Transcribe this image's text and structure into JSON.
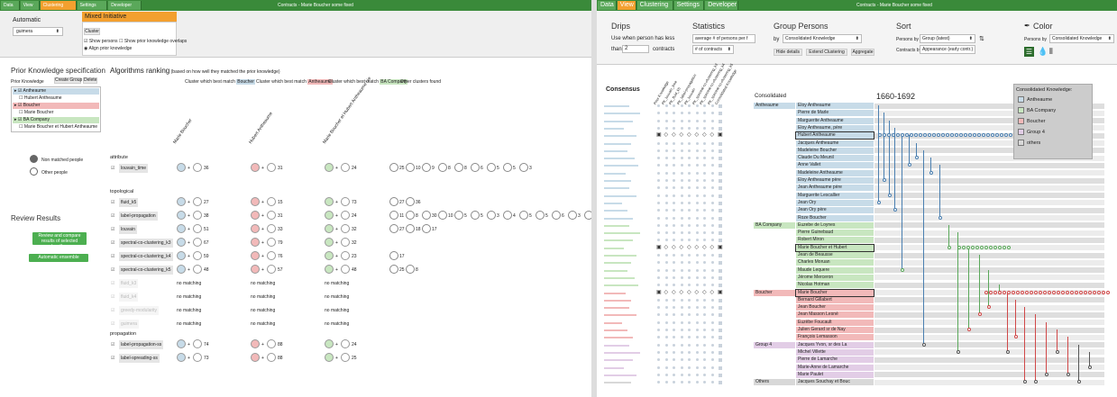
{
  "left": {
    "tabs": [
      "Data",
      "View",
      "Clustering",
      "Settings",
      "Developer"
    ],
    "active_tab": "Clustering",
    "title": "Contracts - Marie Boucher some fixed",
    "automatic_label": "Automatic",
    "algo_select": "guimera",
    "mixed_label": "Mixed Initiative",
    "cluster_btn": "Cluster",
    "show_persons": "Show persons",
    "show_overlaps": "Show prior knowledge overlaps",
    "align_prior": "Align prior knowledge",
    "pk_spec_title": "Prior Knowledge specification",
    "pk_label": "Prior Knowledge",
    "create_group": "Create Group",
    "delete": "Delete",
    "pk_items": [
      {
        "label": "Antheaume",
        "kind": "group",
        "color": "#c7dbe8"
      },
      {
        "label": "Hubert Antheaume",
        "kind": "member",
        "color": ""
      },
      {
        "label": "Boucher",
        "kind": "group",
        "color": "#f2b9b9"
      },
      {
        "label": "Marie Boucher",
        "kind": "member",
        "color": ""
      },
      {
        "label": "BA Company",
        "kind": "group",
        "color": "#c8e6c0"
      },
      {
        "label": "Marie Boucher et Hubert Antheaume",
        "kind": "member",
        "color": ""
      }
    ],
    "non_matched": "Non matched people",
    "other_people": "Other people",
    "review_title": "Review Results",
    "review_btn": "Review and compare results of selected algorithms",
    "ensemble_btn": "Automatic ensemble clustering",
    "alg_title": "Algorithms ranking",
    "alg_subtitle": "(based on how well they matched the prior knowledge)",
    "best_match_prefix": "Cluster which best match",
    "best_boucher": "Boucher",
    "best_antheaume": "Antheaume",
    "best_ba": "BA Company",
    "other_clusters": "Other clusters found",
    "col_heads": [
      "Marie Boucher",
      "Hubert Antheaume",
      "Marie Boucher et Hubert Antheaume Lie"
    ],
    "sections": [
      {
        "name": "attribute",
        "rows": [
          {
            "name": "louvain_time",
            "en": true,
            "v": [
              "36",
              "31",
              "24"
            ],
            "others": [
              "25",
              "10",
              "9",
              "8",
              "8",
              "6",
              "5",
              "5",
              "3"
            ]
          }
        ]
      },
      {
        "name": "topological",
        "rows": [
          {
            "name": "fluid_k5",
            "en": true,
            "v": [
              "27",
              "15",
              "73"
            ],
            "others": [
              "27",
              "36"
            ]
          },
          {
            "name": "label-propagation",
            "en": true,
            "v": [
              "38",
              "31",
              "24"
            ],
            "others": [
              "11",
              "8",
              "30",
              "10",
              "5",
              "5",
              "3",
              "4",
              "5",
              "5",
              "6",
              "3",
              "8"
            ]
          },
          {
            "name": "louvain",
            "en": true,
            "v": [
              "51",
              "33",
              "32"
            ],
            "others": [
              "27",
              "18",
              "17"
            ]
          },
          {
            "name": "spectral-co-clustering_k3",
            "en": true,
            "v": [
              "67",
              "79",
              "32"
            ],
            "others": []
          },
          {
            "name": "spectral-co-clustering_k4",
            "en": true,
            "v": [
              "59",
              "76",
              "23"
            ],
            "others": [
              "17"
            ]
          },
          {
            "name": "spectral-co-clustering_k5",
            "en": true,
            "v": [
              "48",
              "57",
              "48"
            ],
            "others": [
              "25",
              "8"
            ]
          },
          {
            "name": "fluid_k3",
            "en": false,
            "v": [
              "no matching",
              "no matching",
              "no matching"
            ],
            "others": []
          },
          {
            "name": "fluid_k4",
            "en": false,
            "v": [
              "no matching",
              "no matching",
              "no matching"
            ],
            "others": []
          },
          {
            "name": "greedy-modularity",
            "en": false,
            "v": [
              "no matching",
              "no matching",
              "no matching"
            ],
            "others": []
          },
          {
            "name": "guimera",
            "en": false,
            "v": [
              "no matching",
              "no matching",
              "no matching"
            ],
            "others": []
          }
        ]
      },
      {
        "name": "propagation",
        "rows": [
          {
            "name": "label-propagation-ss",
            "en": true,
            "v": [
              "74",
              "88",
              "24"
            ],
            "others": []
          },
          {
            "name": "label-spreading-ss",
            "en": true,
            "v": [
              "73",
              "88",
              "25"
            ],
            "others": []
          }
        ]
      }
    ]
  },
  "right": {
    "tabs": [
      "Data",
      "View",
      "Clustering",
      "Settings",
      "Developer"
    ],
    "active_tab": "View",
    "title": "Contracts - Marie Boucher some fixed",
    "drips_title": "Drips",
    "drips_text1": "Use when person has less",
    "drips_than": "than",
    "drips_value": "2",
    "drips_contracts": "contracts",
    "stats_title": "Statistics",
    "stats_sel1": "average # of persons per f",
    "stats_sel2": "# of contracts",
    "gp_title": "Group Persons",
    "gp_by": "by",
    "gp_sel": "Consolidated Knowledge",
    "hide_details": "Hide details",
    "extend_clustering": "Extend Clustering",
    "aggregate": "Aggregate",
    "sort_title": "Sort",
    "sort_persons_by": "Persons by",
    "sort_persons_sel": "Group (latest)",
    "sort_contracts_by": "Contracts by",
    "sort_contracts_sel": "Appearance (early contr.)",
    "color_title": "Color",
    "color_persons_by": "Persons by",
    "color_sel": "Consolidated Knowledge",
    "consensus": "Consensus",
    "consolidated": "Consolidated",
    "year_range": "1660-1692",
    "matrix_cols": [
      "Prior Knowledge",
      "PK_louvain_time",
      "PK_fluid_k5",
      "PK_label-propagation",
      "PK_louvain",
      "PK_spectral-co-clustering_k3",
      "PK_spectral-co-clustering_k4",
      "PK_spectral-co-clustering_k5",
      "Consolidated Knowledge"
    ],
    "legend_title": "Consolidated Knowledge:",
    "legend": [
      {
        "label": "Antheaume",
        "color": "#c7dbe8"
      },
      {
        "label": "BA Company",
        "color": "#c8e6c0"
      },
      {
        "label": "Boucher",
        "color": "#f2b9b9"
      },
      {
        "label": "Group 4",
        "color": "#e2cde6"
      },
      {
        "label": "others",
        "color": "#d8d8d8"
      }
    ],
    "groups": [
      {
        "name": "Antheaume",
        "color": "#c7dbe8",
        "line": "#4a7fb0",
        "persons": [
          "Eloy Antheaume",
          "Pierre de Marle",
          "Marguerite Antheaume",
          "Eloy Antheaume, père",
          "Hubert Antheaume",
          "Jacques Antheaume",
          "Madeleine Boucher",
          "Claude Du Meunil",
          "Anne Vallet",
          "Madeleine Antheaume",
          "Eloy Antheaume père",
          "Jean Antheaume père",
          "Marguerite Lescallier",
          "Jean Ory",
          "Jean Ory père",
          "Roze Boucher"
        ]
      },
      {
        "name": "BA Company",
        "color": "#c8e6c0",
        "line": "#5aa85a",
        "persons": [
          "Euzebe de Loynes",
          "Pierre Guinebaud",
          "Robert Miron",
          "Marie Boucher et Hubert",
          "Jean de Beausse",
          "Charles Moruan",
          "Maude Lequere",
          "Jérome Merceron",
          "Nicolas Hotman"
        ]
      },
      {
        "name": "Boucher",
        "color": "#f2b9b9",
        "line": "#d04848",
        "persons": [
          "Marie Boucher",
          "Bernard Gillabert",
          "Jean Boucher",
          "Jean Masson Lesné",
          "Euzèbe Foucault",
          "Julien Gerard sr de Nay",
          "François Lemasson"
        ]
      },
      {
        "name": "Group 4",
        "color": "#e2cde6",
        "line": "#555",
        "persons": [
          "Jacques Yvon, sr des La",
          "Michel Villette",
          "Pierre de Lamarche",
          "Marie-Anne de Lamarche",
          "Marie Paulet"
        ]
      },
      {
        "name": "Others",
        "color": "#d8d8d8",
        "line": "#555",
        "persons": [
          "Jacques Souchay et Bouc"
        ]
      }
    ],
    "highlighted": [
      "Hubert Antheaume",
      "Marie Boucher et Hubert",
      "Marie Boucher"
    ]
  }
}
